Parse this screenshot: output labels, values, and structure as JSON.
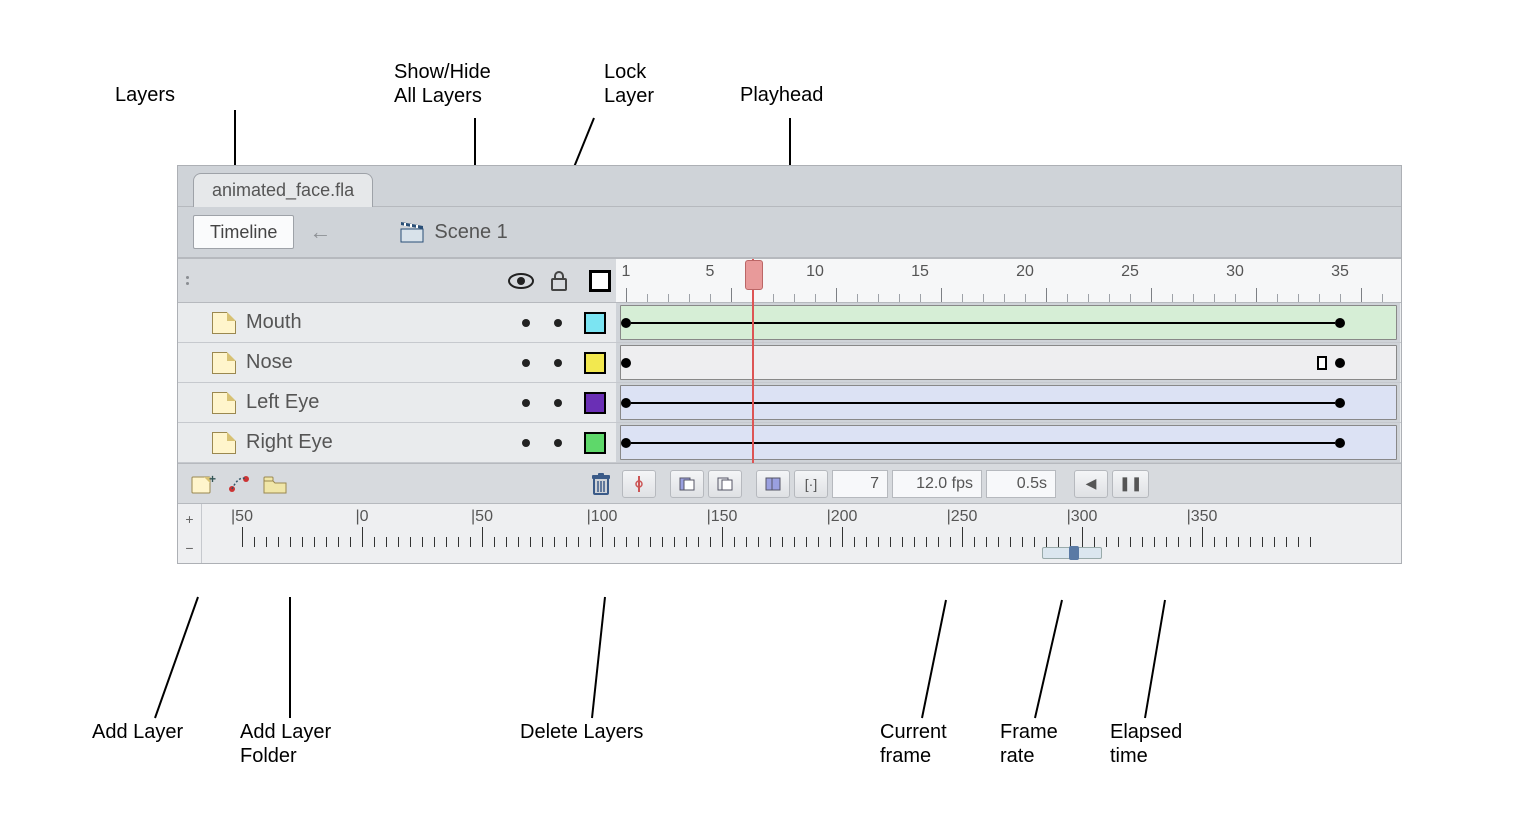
{
  "callouts": {
    "layers": "Layers",
    "showHide": "Show/Hide\nAll Layers",
    "lockLayer": "Lock\nLayer",
    "playhead": "Playhead",
    "addLayer": "Add Layer",
    "addLayerFolder": "Add Layer\nFolder",
    "deleteLayers": "Delete Layers",
    "currentFrame": "Current\nframe",
    "frameRate": "Frame\nrate",
    "elapsedTime": "Elapsed\ntime"
  },
  "fileTab": "animated_face.fla",
  "timelineBtn": "Timeline",
  "sceneLabel": "Scene 1",
  "frameRulerTicks": [
    "1",
    "5",
    "10",
    "15",
    "20",
    "25",
    "30",
    "35"
  ],
  "playheadFrame": 7,
  "layers": [
    {
      "name": "Mouth",
      "color": "#7be4f2",
      "trackBg": "var(--track-green)",
      "hasLine": true,
      "endHollow": false
    },
    {
      "name": "Nose",
      "color": "#f2e84f",
      "trackBg": "var(--track-plain)",
      "hasLine": false,
      "endHollow": true
    },
    {
      "name": "Left Eye",
      "color": "#6a2fb5",
      "trackBg": "var(--track-blue)",
      "hasLine": true,
      "endHollow": false
    },
    {
      "name": "Right Eye",
      "color": "#5ed86a",
      "trackBg": "var(--track-blue)",
      "hasLine": true,
      "endHollow": false
    }
  ],
  "status": {
    "currentFrame": "7",
    "frameRate": "12.0 fps",
    "elapsed": "0.5s"
  },
  "stageRuler": [
    "|50",
    "|0",
    "|50",
    "|100",
    "|150",
    "|200",
    "|250",
    "|300",
    "|350"
  ]
}
